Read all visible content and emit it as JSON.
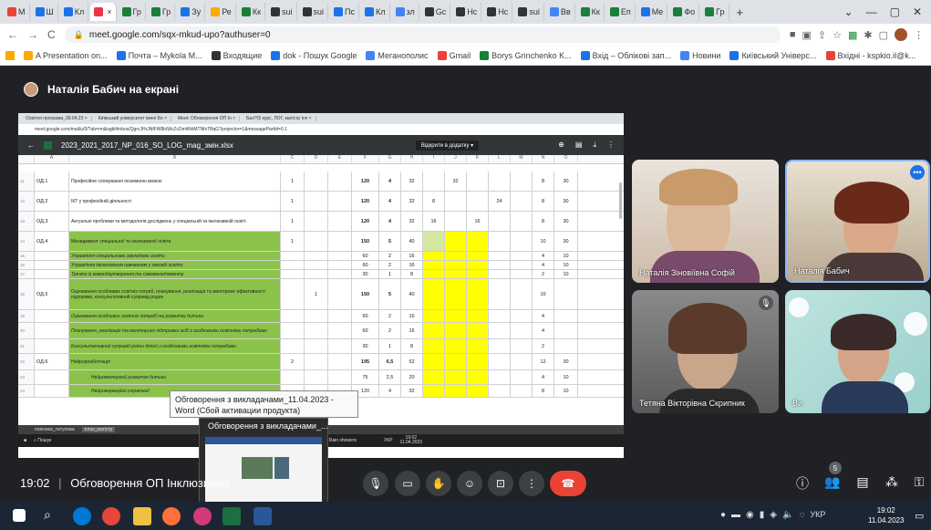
{
  "browser": {
    "tabs": [
      "M",
      "Ш",
      "Кл",
      "",
      "Гр",
      "Гр",
      "Зу",
      "Ре",
      "Кк",
      "sui",
      "sui",
      "Пс",
      "Кл",
      "зл",
      "Gc",
      "Нс",
      "Нс",
      "sui",
      "Вв",
      "Кк",
      "Еп",
      "Ме",
      "Фо",
      "Гр"
    ],
    "new_tab": "+",
    "url": "meet.google.com/sqx-mkud-upo?authuser=0",
    "bookmarks": [
      "A Presentation on...",
      "Почта – Mykola M...",
      "Входящие",
      "dok - Пошук Google",
      "Меганополис",
      "Gmail",
      "Borys Grinchenko K...",
      "Вхід – Облікові зап...",
      "Новини",
      "Київський Універс...",
      "Вхідні - kspkio.il@k..."
    ]
  },
  "meet": {
    "presenter": "Наталія Бабич на екрані",
    "time_label": "19:02",
    "separator": "|",
    "meeting_title": "Обговорення ОП Інклюзивна",
    "participants_count": "5",
    "tiles": [
      {
        "name": "Наталія Зіновіївна Софій"
      },
      {
        "name": "Наталія Бабич"
      },
      {
        "name": "Тетяна Вікторівна Скрипник"
      },
      {
        "name": "Ви"
      }
    ]
  },
  "shared_screen": {
    "tabs": [
      "Освітня програма_09.04.23 ×",
      "Київський університет імені Бо ×",
      "Meet: Обговорення ОП Ін ×",
      "Бал?(5 курс, ЛОГ, магістр Інч ×"
    ],
    "url": "meet.google.com/mail/u/0/?ab=rm&ogbl#inbox/QgrcJHrJNfFW8ktWcZcDmWktMTNfsTBqG?projector=1&messagePartId=0.1",
    "file_name": "2023_2021_2017_NP_016_SO_LOG_mag_змін.xlsx",
    "open_with": "Відкрити в додатку",
    "columns": [
      "A",
      "B",
      "C",
      "D",
      "E",
      "F",
      "G",
      "H",
      "I",
      "J",
      "K",
      "L",
      "M",
      "N",
      "O"
    ],
    "rows": [
      {
        "n": "11",
        "code": "ОД.1",
        "title": "Професійне спілкування іноземною мовою",
        "c": "1",
        "d": "",
        "f": "120",
        "g": "4",
        "h": "32",
        "i": "",
        "j": "32",
        "k": "",
        "l": "",
        "n2": "8",
        "o": "30"
      },
      {
        "n": "12",
        "code": "ОД.2",
        "title": "ІКТ у професійній діяльності",
        "c": "1",
        "d": "",
        "f": "120",
        "g": "4",
        "h": "32",
        "i": "8",
        "j": "",
        "k": "",
        "l": "24",
        "n2": "8",
        "o": "30"
      },
      {
        "n": "13",
        "code": "ОД.3",
        "title": "Актуальні проблеми та методологія досліджень у спеціальній та інклюзивній освіті",
        "c": "1",
        "d": "",
        "f": "120",
        "g": "4",
        "h": "32",
        "i": "16",
        "j": "",
        "k": "16",
        "l": "",
        "n2": "8",
        "o": "30"
      },
      {
        "n": "14",
        "code": "ОД.4",
        "title": "Менеджмент спеціальної та інклюзивної освіти",
        "c": "1",
        "d": "",
        "f": "150",
        "g": "5",
        "h": "40",
        "i": "",
        "j": "",
        "k": "",
        "l": "",
        "n2": "10",
        "o": "30"
      },
      {
        "n": "15",
        "code": "",
        "title": "Управління спеціальними закладами освіти",
        "c": "",
        "d": "",
        "f": "60",
        "g": "2",
        "h": "16",
        "i": "",
        "j": "",
        "k": "",
        "l": "",
        "n2": "4",
        "o": "10"
      },
      {
        "n": "16",
        "code": "",
        "title": "Управління інклюзивним навчанням у закладі освіти",
        "c": "",
        "d": "",
        "f": "60",
        "g": "2",
        "h": "16",
        "i": "",
        "j": "",
        "k": "",
        "l": "",
        "n2": "4",
        "o": "10"
      },
      {
        "n": "17",
        "code": "",
        "title": "Тренінг із командоутворення та самоменеджменту",
        "c": "",
        "d": "",
        "f": "30",
        "g": "1",
        "h": "8",
        "i": "",
        "j": "",
        "k": "",
        "l": "",
        "n2": "2",
        "o": "10"
      },
      {
        "n": "18",
        "code": "ОД.5",
        "title": "Оцінювання особливих освітніх потреб, планування, реалізація та моніторинг ефективності підтримки, консультативний супровід родин",
        "c": "",
        "d": "1",
        "f": "150",
        "g": "5",
        "h": "40",
        "i": "",
        "j": "",
        "k": "",
        "l": "",
        "n2": "10",
        "o": ""
      },
      {
        "n": "19",
        "code": "",
        "title": "Оцінювання особливих освітніх потреб та розвитку дитини",
        "c": "",
        "d": "",
        "f": "60",
        "g": "2",
        "h": "16",
        "i": "",
        "j": "",
        "k": "",
        "l": "",
        "n2": "4",
        "o": ""
      },
      {
        "n": "20",
        "code": "",
        "title": "Планування, реалізація та моніторинг підтримки осіб з особливими освітніми потребами",
        "c": "",
        "d": "",
        "f": "60",
        "g": "2",
        "h": "16",
        "i": "",
        "j": "",
        "k": "",
        "l": "",
        "n2": "4",
        "o": ""
      },
      {
        "n": "21",
        "code": "",
        "title": "Консультативний супровід родин дітей з особливими освітніми потребами",
        "c": "",
        "d": "",
        "f": "30",
        "g": "1",
        "h": "8",
        "i": "",
        "j": "",
        "k": "",
        "l": "",
        "n2": "2",
        "o": ""
      },
      {
        "n": "22",
        "code": "ОД.6",
        "title": "Нейрореабілітація",
        "c": "2",
        "d": "",
        "f": "195",
        "g": "6,5",
        "h": "52",
        "i": "",
        "j": "",
        "k": "",
        "l": "",
        "n2": "12",
        "o": "30"
      },
      {
        "n": "23",
        "code": "",
        "title": "Нейромоторний розвиток дитини",
        "c": "",
        "d": "",
        "f": "75",
        "g": "2,5",
        "h": "20",
        "i": "",
        "j": "",
        "k": "",
        "l": "",
        "n2": "4",
        "o": "10"
      },
      {
        "n": "24",
        "code": "",
        "title": "Нейрокорекційні стратегії",
        "c": "",
        "d": "",
        "f": "120",
        "g": "4",
        "h": "32",
        "i": "",
        "j": "",
        "k": "",
        "l": "",
        "n2": "8",
        "o": "10"
      }
    ],
    "sheet_tabs": [
      "пояснюв_титулова",
      "план_магістр"
    ],
    "taskbar_search": "Пошук",
    "weather": "52°F Rain showers",
    "taskbar_lang": "УКР",
    "taskbar_time": "19:02",
    "taskbar_date": "11.04.2023"
  },
  "tooltip": {
    "text": "Обговорення з викладачами_11.04.2023 - Word (Сбой активации продукта)"
  },
  "thumbnail": {
    "title": "Обговорення з викладачами_..."
  },
  "windows": {
    "lang": "УКР",
    "time": "19:02",
    "date": "11.04.2023"
  },
  "colors": {
    "meet_bg": "#202124",
    "end_call": "#ea4335",
    "green_cell": "#8bc34a",
    "yellow_cell": "#ffff00"
  }
}
